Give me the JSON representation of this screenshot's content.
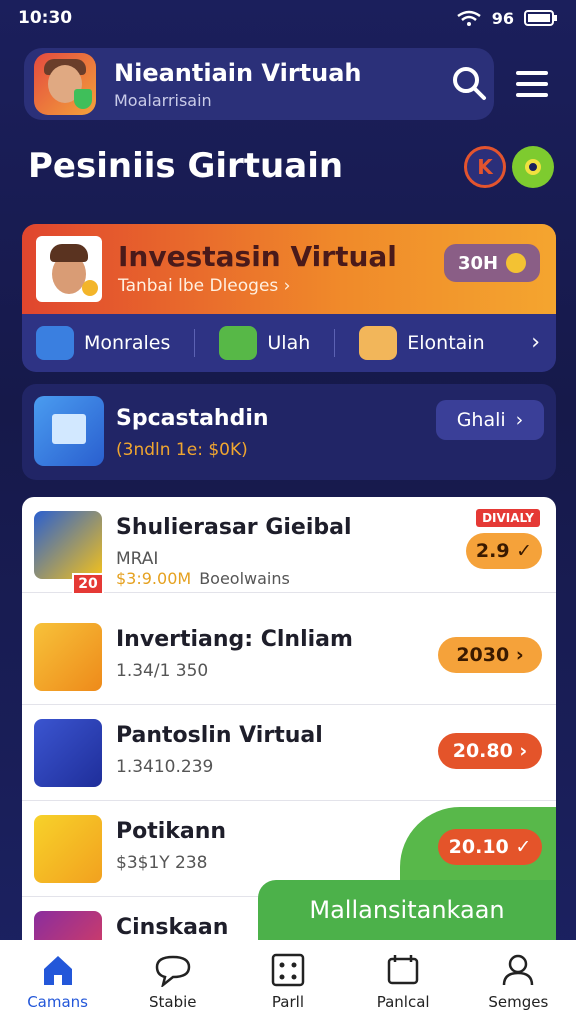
{
  "status_bar": {
    "time": "10:30",
    "network": "96"
  },
  "app_bar": {
    "title": "Nieantiain Virtuah",
    "subtitle": "Moalarrisain"
  },
  "page": {
    "title": "Pesiniis Girtuain"
  },
  "hero": {
    "title": "Investasin Virtual",
    "subtitle": "Tanbai lbe Dleoges ›",
    "pill": "30H",
    "actions": [
      "Monrales",
      "Ulah",
      "Elontain"
    ]
  },
  "promo": {
    "title": "Spcastahdin",
    "subtitle": "(3ndln 1e: $0K)",
    "button": "Ghali"
  },
  "list": [
    {
      "title": "Shulierasar Gieibal",
      "sub": "MRAI",
      "amount": "$3:9.00M",
      "amount_note": "Boeolwains",
      "badge": "20",
      "tag": "DIVIALY",
      "pill": "2.9 ✓",
      "icon_color": "#2a5fcf"
    },
    {
      "title": "Invertiang: Clnliam",
      "sub": "1.34/1 350",
      "pill": "2030 ›",
      "icon_color": "#f2a11f"
    },
    {
      "title": "Pantoslin Virtual",
      "sub": "1.3410.239",
      "pill": "20.80 ›",
      "icon_color": "#2f4ac0"
    },
    {
      "title": "Potikann",
      "sub": "$3$1Y 238",
      "pill": "20.10 ✓",
      "icon_color": "#f5c21a"
    },
    {
      "title": "Cinskaan",
      "sub": "",
      "icon_color": "#7b2a8f"
    }
  ],
  "green_banner": "Mallansitankaan",
  "tabs": [
    "Camans",
    "Stabie",
    "Parll",
    "Panlcal",
    "Semges"
  ]
}
